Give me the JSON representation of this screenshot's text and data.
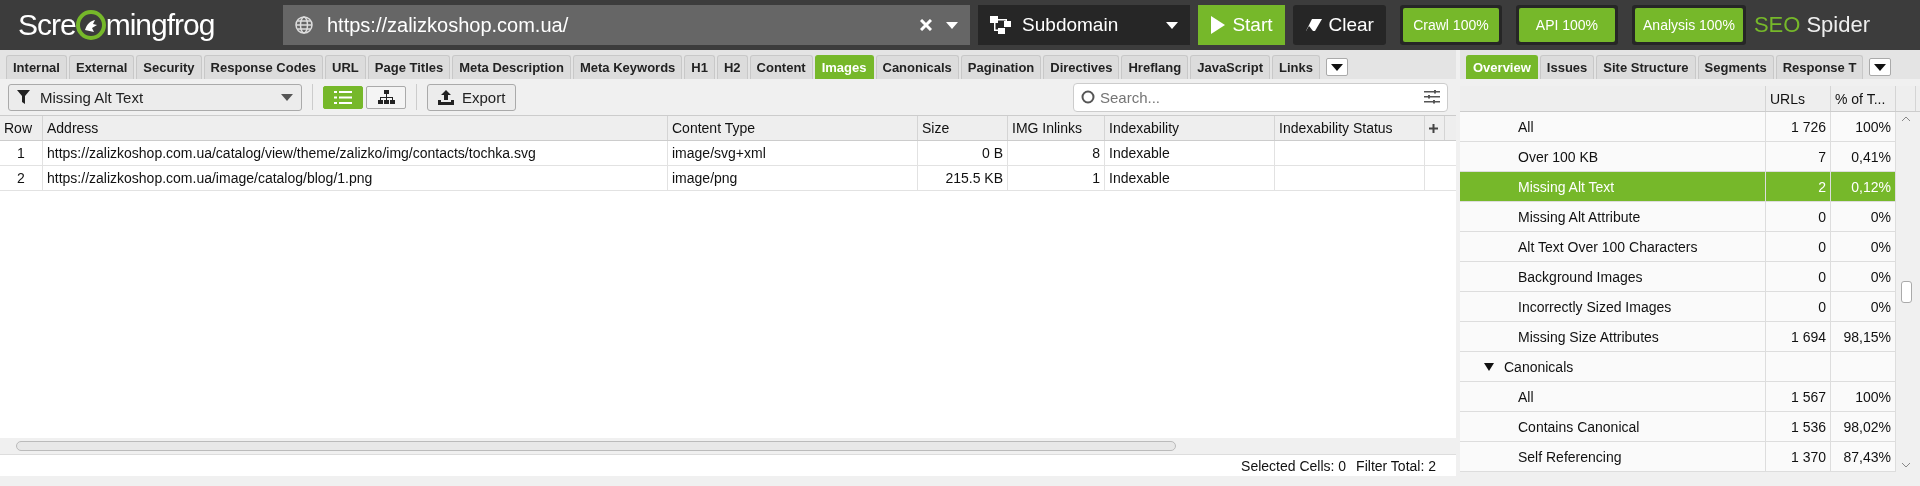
{
  "header": {
    "logo": {
      "before": "Scre",
      "after": "mingfrog"
    },
    "url": "https://zalizkoshop.com.ua/",
    "mode": "Subdomain",
    "start": "Start",
    "clear": "Clear",
    "progress": [
      "Crawl 100%",
      "API 100%",
      "Analysis 100%"
    ],
    "brand": {
      "first": "SEO",
      "second": "Spider"
    }
  },
  "tabs": [
    {
      "label": "Internal",
      "selected": false
    },
    {
      "label": "External",
      "selected": false
    },
    {
      "label": "Security",
      "selected": false
    },
    {
      "label": "Response Codes",
      "selected": false
    },
    {
      "label": "URL",
      "selected": false
    },
    {
      "label": "Page Titles",
      "selected": false
    },
    {
      "label": "Meta Description",
      "selected": false
    },
    {
      "label": "Meta Keywords",
      "selected": false
    },
    {
      "label": "H1",
      "selected": false
    },
    {
      "label": "H2",
      "selected": false
    },
    {
      "label": "Content",
      "selected": false
    },
    {
      "label": "Images",
      "selected": true
    },
    {
      "label": "Canonicals",
      "selected": false
    },
    {
      "label": "Pagination",
      "selected": false
    },
    {
      "label": "Directives",
      "selected": false
    },
    {
      "label": "Hreflang",
      "selected": false
    },
    {
      "label": "JavaScript",
      "selected": false
    },
    {
      "label": "Links",
      "selected": false
    }
  ],
  "toolbar": {
    "filter": "Missing Alt Text",
    "views": [
      {
        "kind": "list",
        "selected": true
      },
      {
        "kind": "tree",
        "selected": false
      }
    ],
    "export": "Export",
    "search": {
      "placeholder": "Search..."
    }
  },
  "table": {
    "columns": [
      "Row",
      "Address",
      "Content Type",
      "Size",
      "IMG Inlinks",
      "Indexability",
      "Indexability Status"
    ],
    "rows": [
      [
        "1",
        "https://zalizkoshop.com.ua/catalog/view/theme/zalizko/img/contacts/tochka.svg",
        "image/svg+xml",
        "0 B",
        "8",
        "Indexable",
        ""
      ],
      [
        "2",
        "https://zalizkoshop.com.ua/image/catalog/blog/1.png",
        "image/png",
        "215.5 KB",
        "1",
        "Indexable",
        ""
      ]
    ]
  },
  "status_bar": [
    "Selected Cells: 0",
    "Filter Total: 2"
  ],
  "side_tabs": [
    {
      "label": "Overview",
      "selected": true
    },
    {
      "label": "Issues",
      "selected": false
    },
    {
      "label": "Site Structure",
      "selected": false
    },
    {
      "label": "Segments",
      "selected": false
    },
    {
      "label": "Response T",
      "selected": false
    }
  ],
  "overview": {
    "columns": [
      "URLs",
      "% of T..."
    ],
    "items": [
      {
        "kind": "item",
        "label": "All",
        "urls": "1 726",
        "percent": "100%",
        "selected": false
      },
      {
        "kind": "item",
        "label": "Over 100 KB",
        "urls": "7",
        "percent": "0,41%",
        "selected": false
      },
      {
        "kind": "item",
        "label": "Missing Alt Text",
        "urls": "2",
        "percent": "0,12%",
        "selected": true
      },
      {
        "kind": "item",
        "label": "Missing Alt Attribute",
        "urls": "0",
        "percent": "0%",
        "selected": false
      },
      {
        "kind": "item",
        "label": "Alt Text Over 100 Characters",
        "urls": "0",
        "percent": "0%",
        "selected": false
      },
      {
        "kind": "item",
        "label": "Background Images",
        "urls": "0",
        "percent": "0%",
        "selected": false
      },
      {
        "kind": "item",
        "label": "Incorrectly Sized Images",
        "urls": "0",
        "percent": "0%",
        "selected": false
      },
      {
        "kind": "item",
        "label": "Missing Size Attributes",
        "urls": "1 694",
        "percent": "98,15%",
        "selected": false
      },
      {
        "kind": "group",
        "label": "Canonicals",
        "expanded": true,
        "children": [
          {
            "kind": "item",
            "label": "All",
            "urls": "1 567",
            "percent": "100%",
            "selected": false
          },
          {
            "kind": "item",
            "label": "Contains Canonical",
            "urls": "1 536",
            "percent": "98,02%",
            "selected": false
          },
          {
            "kind": "item",
            "label": "Self Referencing",
            "urls": "1 370",
            "percent": "87,43%",
            "selected": false
          }
        ]
      }
    ]
  }
}
